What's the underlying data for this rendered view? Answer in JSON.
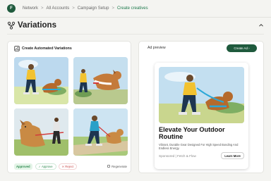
{
  "breadcrumb": {
    "avatar_initial": "F",
    "items": [
      "Network",
      "All Accounts",
      "Campaign Setup",
      "Create creatives"
    ],
    "separator": ">"
  },
  "section": {
    "title": "Variations",
    "icon": "variations-icon",
    "collapse_icon": "chevron-up-icon"
  },
  "variations_panel": {
    "title": "Create Automated Variations",
    "thumbnails": [
      "variation-1",
      "variation-2",
      "variation-3",
      "variation-4"
    ],
    "approved_label": "Approved",
    "approve_label": "✓ Approve",
    "reject_label": "✕ Reject",
    "regenerate_label": "Regenerate"
  },
  "ad_preview": {
    "label": "Ad preview",
    "create_ad_label": "Create Ad  ›",
    "headline": "Elevate Your Outdoor Routine",
    "description": "Vibrant, Durable Gear Designed For High Speed Bonding And Endless Energy.",
    "sponsor": "Sponsored | Fetch & Flow",
    "cta": "Learn More"
  },
  "colors": {
    "brand_green": "#1f5a3d",
    "accent_green": "#1f7a4d",
    "reject_red": "#c94a4a"
  }
}
